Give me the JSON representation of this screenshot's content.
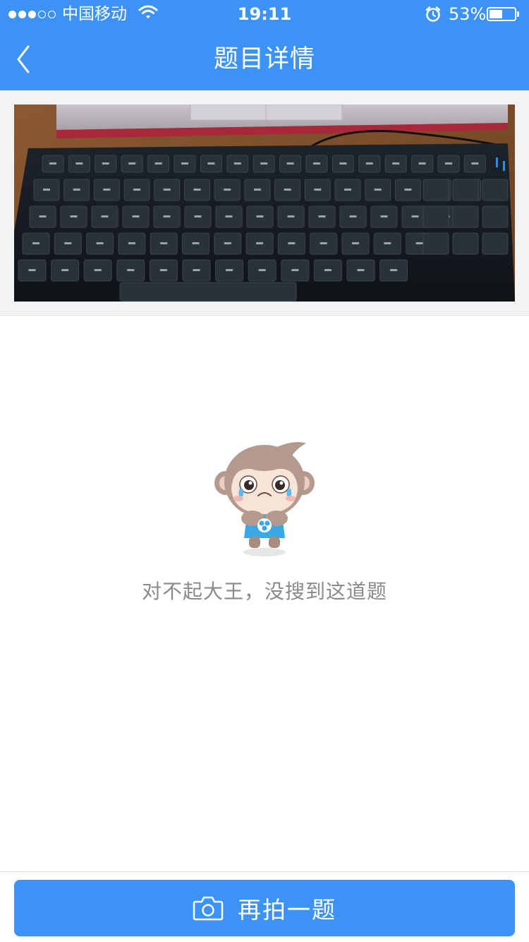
{
  "status_bar": {
    "carrier": "中国移动",
    "time": "19:11",
    "battery_percent": "53%",
    "battery_level": 0.53,
    "signal_bars_filled": 3,
    "signal_bars_total": 5,
    "icons": [
      "wifi-icon",
      "alarm-icon",
      "battery-icon"
    ]
  },
  "nav": {
    "title": "题目详情",
    "back_icon": "chevron-left-icon",
    "background_color": "#3d93f5"
  },
  "question_photo": {
    "icon": "keyboard-photo"
  },
  "empty_state": {
    "mascot_icon": "crying-monkey-icon",
    "message": "对不起大王，没搜到这道题"
  },
  "bottom": {
    "retake_icon": "camera-icon",
    "retake_label": "再拍一题",
    "button_color": "#3d93f5"
  }
}
